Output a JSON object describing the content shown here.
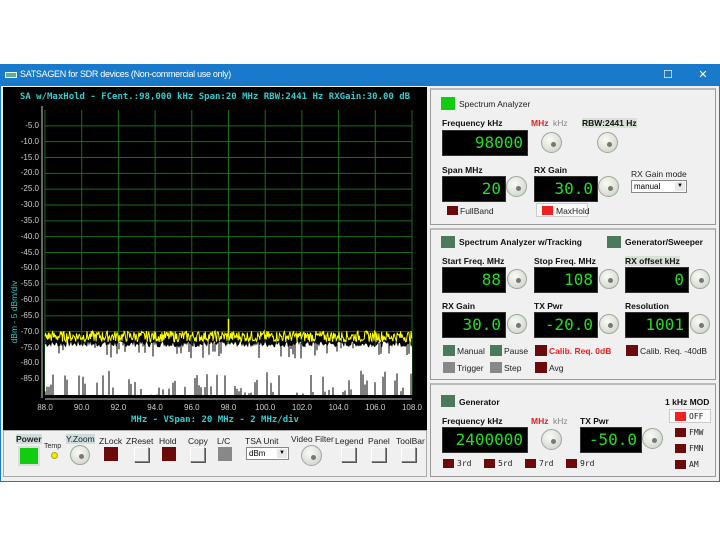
{
  "window": {
    "title": "SATSAGEN for SDR devices (Non-commercial use only)",
    "maximize": "☐",
    "close": "✕"
  },
  "plot": {
    "title": "SA w/MaxHold - FCent.:98,000 kHz Span:20 MHz RBW:2441 Hz RXGain:30.00 dB",
    "footer": "MHz - VSpan: 20 MHz - 2 MHz/div",
    "ylabel": "dBm - 5 dBm/div"
  },
  "chart_data": {
    "type": "line",
    "title": "SA w/MaxHold - FCent.:98,000 kHz Span:20 MHz RBW:2441 Hz RXGain:30.00 dB",
    "xlabel": "MHz - VSpan: 20 MHz - 2 MHz/div",
    "ylabel": "dBm - 5 dBm/div",
    "xlim": [
      88,
      108
    ],
    "ylim": [
      -90,
      0
    ],
    "xticks": [
      "88.0",
      "90.0",
      "92.0",
      "94.0",
      "96.0",
      "98.0",
      "100.0",
      "102.0",
      "104.0",
      "106.0",
      "108.0"
    ],
    "yticks": [
      "-5.0",
      "-10.0",
      "-15.0",
      "-20.0",
      "-25.0",
      "-30.0",
      "-35.0",
      "-40.0",
      "-45.0",
      "-50.0",
      "-55.0",
      "-60.0",
      "-65.0",
      "-70.0",
      "-75.0",
      "-80.0",
      "-85.0"
    ],
    "grid": true,
    "series": [
      {
        "kind": "maxhold",
        "color": "#ffff00",
        "noise_floor_dbm": -71.5,
        "peaks": [
          {
            "x": 98.0,
            "y": -66
          }
        ]
      },
      {
        "kind": "live",
        "color": "#ffffff",
        "noise_floor_dbm": -74
      }
    ],
    "grid_color": "#1a6e1a"
  },
  "controls": {
    "power": "Power",
    "temp": "Temp",
    "yzoom": "Y.Zoom",
    "zlock": "ZLock",
    "zreset": "ZReset",
    "hold": "Hold",
    "copy": "Copy",
    "lc": "L/C",
    "tsa_unit": "TSA Unit",
    "tsa_value": "dBm",
    "video_filter": "Video Filter",
    "legend": "Legend",
    "panel": "Panel",
    "toolbar": "ToolBar"
  },
  "sa": {
    "title": "Spectrum Analyzer",
    "freq_label": "Frequency kHz",
    "mhz": "MHz",
    "khz": "kHz",
    "rbw": "RBW:2441 Hz",
    "freq": "98000",
    "span_label": "Span MHz",
    "span": "20",
    "rxgain_label": "RX Gain",
    "rxgain": "30.0",
    "mode_label": "RX Gain mode",
    "mode": "manual",
    "fullband": "FullBand",
    "maxhold": "MaxHold"
  },
  "tracking": {
    "title": "Spectrum Analyzer w/Tracking",
    "gen_title": "Generator/Sweeper",
    "start_label": "Start Freq. MHz",
    "start": "88",
    "stop_label": "Stop Freq. MHz",
    "stop": "108",
    "offset_label": "RX offset kHz",
    "offset": "0",
    "rxgain_label": "RX Gain",
    "rxgain": "30.0",
    "txpwr_label": "TX Pwr",
    "txpwr": "-20.0",
    "res_label": "Resolution",
    "res": "1001",
    "manual": "Manual",
    "pause": "Pause",
    "calib0": "Calib. Req. 0dB",
    "calib40": "Calib. Req. -40dB",
    "trigger": "Trigger",
    "step": "Step",
    "avg": "Avg"
  },
  "generator": {
    "title": "Generator",
    "mod_title": "1 kHz MOD",
    "freq_label": "Frequency kHz",
    "mhz": "MHz",
    "khz": "kHz",
    "freq": "2400000",
    "txpwr_label": "TX Pwr",
    "txpwr": "-50.0",
    "harmonics": [
      "3rd",
      "5rd",
      "7rd",
      "9rd"
    ],
    "mod": [
      "OFF",
      "FMW",
      "FMN",
      "AM"
    ]
  }
}
